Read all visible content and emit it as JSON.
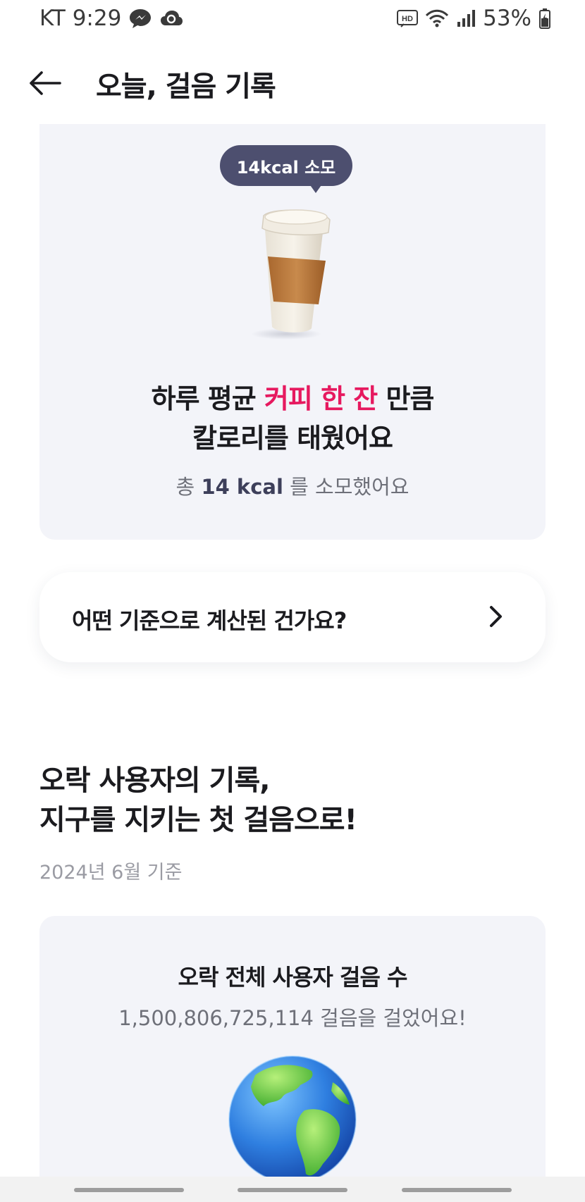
{
  "status_bar": {
    "carrier_time": "KT 9:29",
    "battery": "53%",
    "icons": [
      "messenger-icon",
      "cloud-sync-icon",
      "hd-icon",
      "wifi-icon",
      "signal-icon",
      "battery-icon"
    ]
  },
  "header": {
    "title": "오늘, 걸음 기록",
    "back_icon": "arrow-left-icon"
  },
  "calorie_card": {
    "bubble": "14kcal 소모",
    "headline_prefix": "하루 평균 ",
    "headline_accent": "커피 한 잔",
    "headline_suffix": " 만큼",
    "headline_line2": "칼로리를 태웠어요",
    "sub_prefix": "총 ",
    "sub_value": "14 kcal",
    "sub_suffix": " 를 소모했어요",
    "accent_color": "#e6195f"
  },
  "info_button": {
    "label": "어떤 기준으로 계산된 건가요?"
  },
  "section": {
    "title_line1": "오락 사용자의 기록,",
    "title_line2": "지구를 지키는 첫 걸음으로!",
    "date": "2024년 6월 기준"
  },
  "steps_card": {
    "title": "오락 전체 사용자 걸음 수",
    "value": "1,500,806,725,114 걸음을 걸었어요!"
  }
}
